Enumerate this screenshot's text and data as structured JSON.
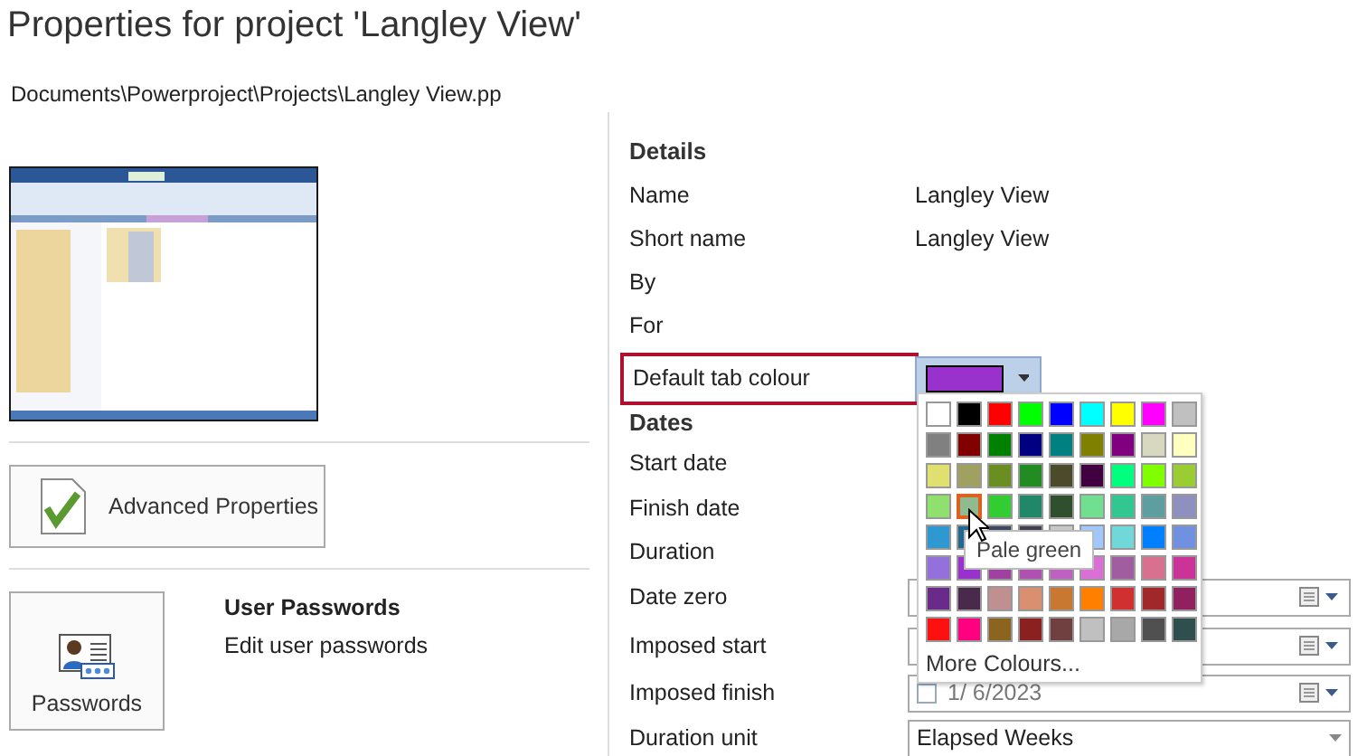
{
  "title": "Properties for project 'Langley View'",
  "path": "Documents\\Powerproject\\Projects\\Langley View.pp",
  "advanced_button": {
    "label": "Advanced Properties"
  },
  "passwords": {
    "button": "Passwords",
    "heading": "User Passwords",
    "description": "Edit user passwords"
  },
  "details": {
    "heading": "Details",
    "rows": [
      {
        "label": "Name",
        "value": "Langley View"
      },
      {
        "label": "Short name",
        "value": "Langley View"
      },
      {
        "label": "By"
      },
      {
        "label": "For"
      }
    ],
    "tab_colour": {
      "label": "Default tab colour",
      "color": "#9932cc"
    }
  },
  "dates": {
    "heading": "Dates",
    "rows": [
      {
        "label": "Start date",
        "kind": "none"
      },
      {
        "label": "Finish date",
        "kind": "none"
      },
      {
        "label": "Duration",
        "kind": "none"
      },
      {
        "label": "Date zero",
        "kind": "date"
      },
      {
        "label": "Imposed start",
        "kind": "date"
      },
      {
        "label": "Imposed finish",
        "kind": "date",
        "checked": false,
        "value": "1/  6/2023"
      },
      {
        "label": "Duration unit",
        "kind": "dropdown",
        "value": "Elapsed Weeks"
      }
    ]
  },
  "palette": {
    "colors": [
      {
        "color": "#ffffff",
        "selected": false
      },
      {
        "color": "#000000",
        "selected": false
      },
      {
        "color": "#ff0000",
        "selected": false
      },
      {
        "color": "#00ff00",
        "selected": false
      },
      {
        "color": "#0000ff",
        "selected": false
      },
      {
        "color": "#00ffff",
        "selected": false
      },
      {
        "color": "#ffff00",
        "selected": false
      },
      {
        "color": "#ff00ff",
        "selected": false
      },
      {
        "color": "#c0c0c0",
        "selected": false
      },
      {
        "color": "#808080",
        "selected": false
      },
      {
        "color": "#800000",
        "selected": false
      },
      {
        "color": "#008000",
        "selected": false
      },
      {
        "color": "#000080",
        "selected": false
      },
      {
        "color": "#008080",
        "selected": false
      },
      {
        "color": "#808000",
        "selected": false
      },
      {
        "color": "#800080",
        "selected": false
      },
      {
        "color": "#d8d8c0",
        "selected": false
      },
      {
        "color": "#ffffc0",
        "selected": false
      },
      {
        "color": "#e0e070",
        "selected": false
      },
      {
        "color": "#a0a060",
        "selected": false
      },
      {
        "color": "#6b8e23",
        "selected": false
      },
      {
        "color": "#228b22",
        "selected": false
      },
      {
        "color": "#4b4b2b",
        "selected": false
      },
      {
        "color": "#400040",
        "selected": false
      },
      {
        "color": "#00ff7f",
        "selected": false
      },
      {
        "color": "#7fff00",
        "selected": false
      },
      {
        "color": "#9acd32",
        "selected": false
      },
      {
        "color": "#90e070",
        "selected": false
      },
      {
        "color": "#8fbc8f",
        "selected": true
      },
      {
        "color": "#32cd32",
        "selected": false
      },
      {
        "color": "#208868",
        "selected": false
      },
      {
        "color": "#2f4f2f",
        "selected": false
      },
      {
        "color": "#70e090",
        "selected": false
      },
      {
        "color": "#30c890",
        "selected": false
      },
      {
        "color": "#5f9ea0",
        "selected": false
      },
      {
        "color": "#9090c0",
        "selected": false
      },
      {
        "color": "#3098d0",
        "selected": false
      },
      {
        "color": "#206890",
        "selected": false
      },
      {
        "color": "#404860",
        "selected": false
      },
      {
        "color": "#404050",
        "selected": false
      },
      {
        "color": "#c8c8c8",
        "selected": false
      },
      {
        "color": "#a0c8ff",
        "selected": false
      },
      {
        "color": "#70d8d8",
        "selected": false
      },
      {
        "color": "#0080ff",
        "selected": false
      },
      {
        "color": "#7090e0",
        "selected": false
      },
      {
        "color": "#9370db",
        "selected": false
      },
      {
        "color": "#9932cc",
        "selected": false
      },
      {
        "color": "#a040a0",
        "selected": false
      },
      {
        "color": "#b050b0",
        "selected": false
      },
      {
        "color": "#c060c0",
        "selected": false
      },
      {
        "color": "#da70d6",
        "selected": false
      },
      {
        "color": "#a05ea0",
        "selected": false
      },
      {
        "color": "#d87090",
        "selected": false
      },
      {
        "color": "#cc3399",
        "selected": false
      },
      {
        "color": "#6a2a8a",
        "selected": false
      },
      {
        "color": "#4a2a4a",
        "selected": false
      },
      {
        "color": "#c09090",
        "selected": false
      },
      {
        "color": "#d89070",
        "selected": false
      },
      {
        "color": "#c87830",
        "selected": false
      },
      {
        "color": "#ff8000",
        "selected": false
      },
      {
        "color": "#d03030",
        "selected": false
      },
      {
        "color": "#a02828",
        "selected": false
      },
      {
        "color": "#902060",
        "selected": false
      },
      {
        "color": "#ff1010",
        "selected": false
      },
      {
        "color": "#ff0080",
        "selected": false
      },
      {
        "color": "#8b6420",
        "selected": false
      },
      {
        "color": "#8b2020",
        "selected": false
      },
      {
        "color": "#704040",
        "selected": false
      },
      {
        "color": "#c0c0c0",
        "selected": false
      },
      {
        "color": "#a8a8a8",
        "selected": false
      },
      {
        "color": "#505050",
        "selected": false
      },
      {
        "color": "#2f4f4f",
        "selected": false
      }
    ],
    "more": "More Colours...",
    "tooltip": "Pale green"
  }
}
